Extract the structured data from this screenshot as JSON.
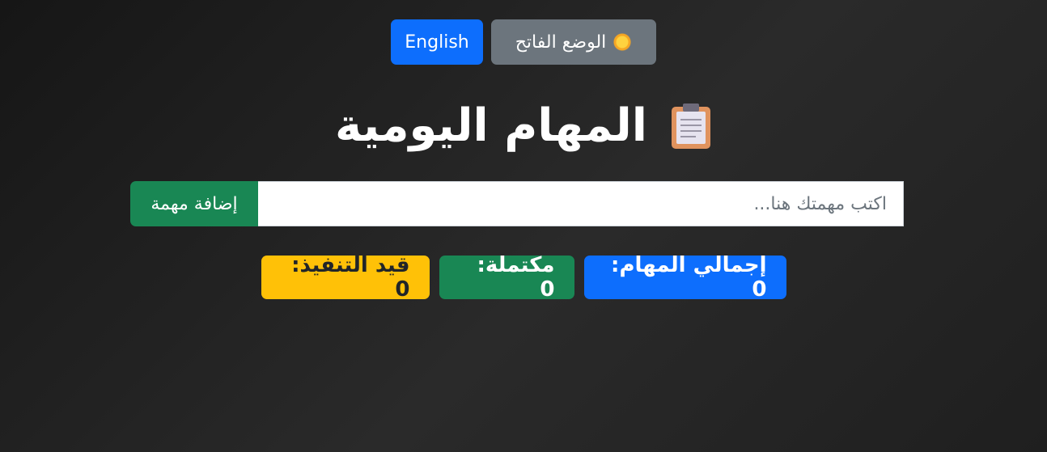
{
  "header": {
    "language_button": "English",
    "theme_button": "الوضع الفاتح",
    "theme_icon": "sun-icon"
  },
  "title": {
    "text": "المهام اليومية",
    "icon": "clipboard-icon"
  },
  "task_form": {
    "input_value": "",
    "input_placeholder": "اكتب مهمتك هنا...",
    "add_button": "إضافة مهمة"
  },
  "stats": {
    "total": "إجمالي المهام: 0",
    "completed": "مكتملة: 0",
    "pending": "قيد التنفيذ: 0"
  },
  "colors": {
    "primary": "#0d6efd",
    "success": "#198754",
    "warning": "#ffc107",
    "secondary": "#6c757d",
    "background": "#222222"
  }
}
